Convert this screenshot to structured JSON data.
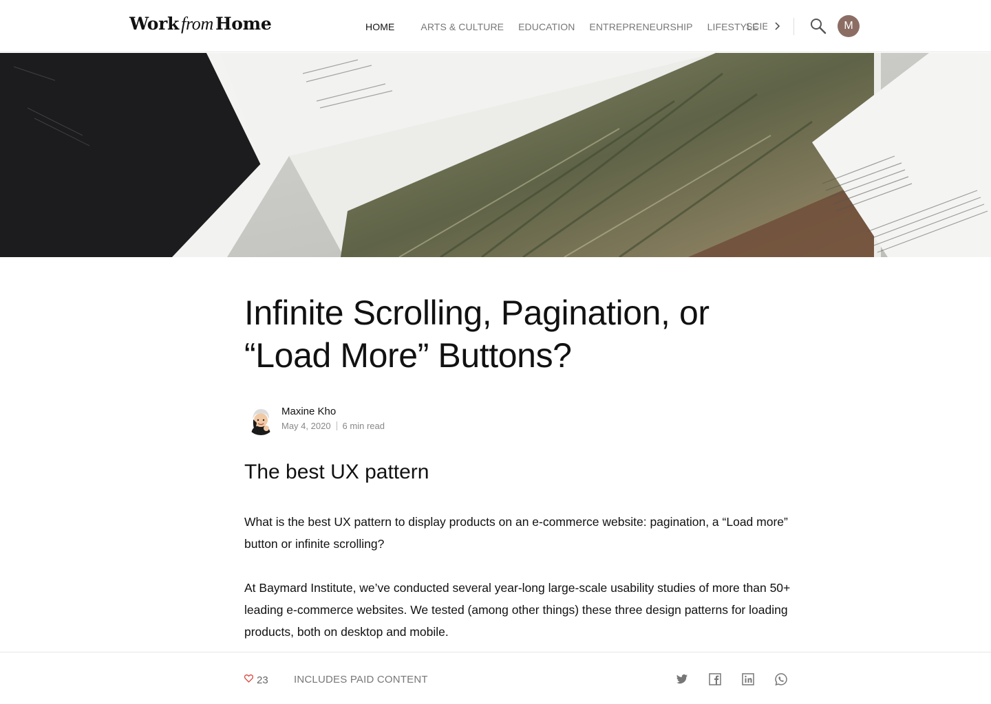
{
  "header": {
    "logo": {
      "part1": "Work",
      "part2": "from",
      "part3": "Home"
    },
    "nav": {
      "active": "HOME",
      "items": [
        "ARTS & CULTURE",
        "EDUCATION",
        "ENTREPRENEURSHIP",
        "LIFESTYLE"
      ],
      "clipped": "SCIENCE"
    },
    "avatar_initial": "M",
    "avatar_color": "#8c6d64"
  },
  "article": {
    "title_lines": [
      "Infinite Scrolling, Pagination, or",
      "“Load More” Buttons?"
    ],
    "author": "Maxine Kho",
    "date": "May 4, 2020",
    "read_time": "6 min read",
    "subtitle": "The best UX pattern",
    "paragraphs": [
      "What is the best UX pattern to display products on an e-commerce website: pagination, a “Load more” button or infinite scrolling?",
      "At Baymard Institute, we’ve conducted several year-long large-scale usability studies of more than 50+ leading e-commerce websites. We tested (among other things) these three design patterns for loading products, both on desktop and mobile."
    ]
  },
  "footer": {
    "likes": "23",
    "paid_label": "INCLUDES PAID CONTENT",
    "like_color": "#d9463b",
    "share_icons": [
      "twitter-icon",
      "facebook-icon",
      "linkedin-icon",
      "whatsapp-icon"
    ]
  }
}
